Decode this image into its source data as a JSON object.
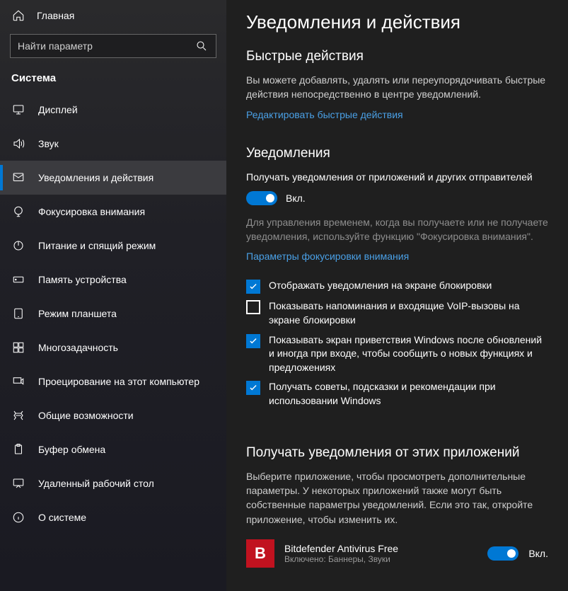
{
  "sidebar": {
    "home_label": "Главная",
    "search_placeholder": "Найти параметр",
    "category": "Система",
    "items": [
      {
        "label": "Дисплей",
        "icon": "display"
      },
      {
        "label": "Звук",
        "icon": "sound"
      },
      {
        "label": "Уведомления и действия",
        "icon": "notifications",
        "active": true
      },
      {
        "label": "Фокусировка внимания",
        "icon": "focus"
      },
      {
        "label": "Питание и спящий режим",
        "icon": "power"
      },
      {
        "label": "Память устройства",
        "icon": "storage"
      },
      {
        "label": "Режим планшета",
        "icon": "tablet"
      },
      {
        "label": "Многозадачность",
        "icon": "multitask"
      },
      {
        "label": "Проецирование на этот компьютер",
        "icon": "project"
      },
      {
        "label": "Общие возможности",
        "icon": "shared"
      },
      {
        "label": "Буфер обмена",
        "icon": "clipboard"
      },
      {
        "label": "Удаленный рабочий стол",
        "icon": "remote"
      },
      {
        "label": "О системе",
        "icon": "about"
      }
    ]
  },
  "main": {
    "title": "Уведомления и действия",
    "quick_actions": {
      "heading": "Быстрые действия",
      "desc": "Вы можете добавлять, удалять или переупорядочивать быстрые действия непосредственно в центре уведомлений.",
      "edit_link": "Редактировать быстрые действия"
    },
    "notifications": {
      "heading": "Уведомления",
      "receive_label": "Получать уведомления от приложений и других отправителей",
      "toggle_state": "Вкл.",
      "focus_desc": "Для управления временем, когда вы получаете или не получаете уведомления, используйте функцию \"Фокусировка внимания\".",
      "focus_link": "Параметры фокусировки внимания",
      "checks": [
        {
          "checked": true,
          "label": "Отображать уведомления на экране блокировки"
        },
        {
          "checked": false,
          "label": "Показывать напоминания и входящие VoIP-вызовы на экране блокировки"
        },
        {
          "checked": true,
          "label": "Показывать экран приветствия Windows после обновлений и иногда при входе, чтобы сообщить о новых функциях и предложениях"
        },
        {
          "checked": true,
          "label": "Получать советы, подсказки и рекомендации при использовании Windows"
        }
      ]
    },
    "apps_section": {
      "heading": "Получать уведомления от этих приложений",
      "desc": "Выберите приложение, чтобы просмотреть дополнительные параметры. У некоторых приложений также могут быть собственные параметры уведомлений. Если это так, откройте приложение, чтобы изменить их.",
      "apps": [
        {
          "name": "Bitdefender Antivirus Free",
          "sub": "Включено: Баннеры, Звуки",
          "badge_letter": "B",
          "toggle_state": "Вкл."
        }
      ]
    }
  }
}
